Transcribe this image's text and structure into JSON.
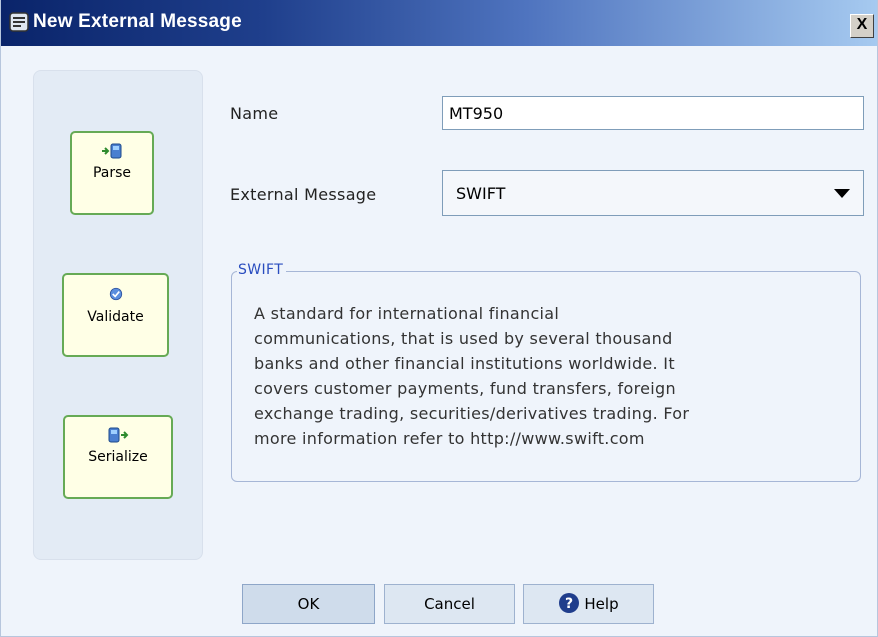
{
  "window": {
    "title": "New External Message",
    "close_label": "X"
  },
  "sidebar": {
    "parse_label": "Parse",
    "validate_label": "Validate",
    "serialize_label": "Serialize"
  },
  "form": {
    "name_label": "Name",
    "name_value": "MT950",
    "external_message_label": "External Message",
    "external_message_value": "SWIFT"
  },
  "description": {
    "legend": "SWIFT",
    "lines": [
      "A standard for international financial",
      "communications, that is used by several thousand",
      "banks and other financial institutions worldwide. It",
      "covers customer payments, fund transfers, foreign",
      "exchange trading, securities/derivatives trading. For",
      "more information refer to http://www.swift.com"
    ]
  },
  "footer": {
    "ok_label": "OK",
    "cancel_label": "Cancel",
    "help_label": "Help"
  },
  "icons": {
    "app": "message-app-icon",
    "parse": "parse-icon",
    "validate": "validate-check-icon",
    "serialize": "serialize-icon",
    "help": "help-question-icon"
  },
  "colors": {
    "titlebar_start": "#0a246a",
    "titlebar_end": "#a6caf0",
    "side_button_bg": "#ffffe6",
    "side_button_border": "#66aa55",
    "legend_text": "#2a4dbf"
  }
}
